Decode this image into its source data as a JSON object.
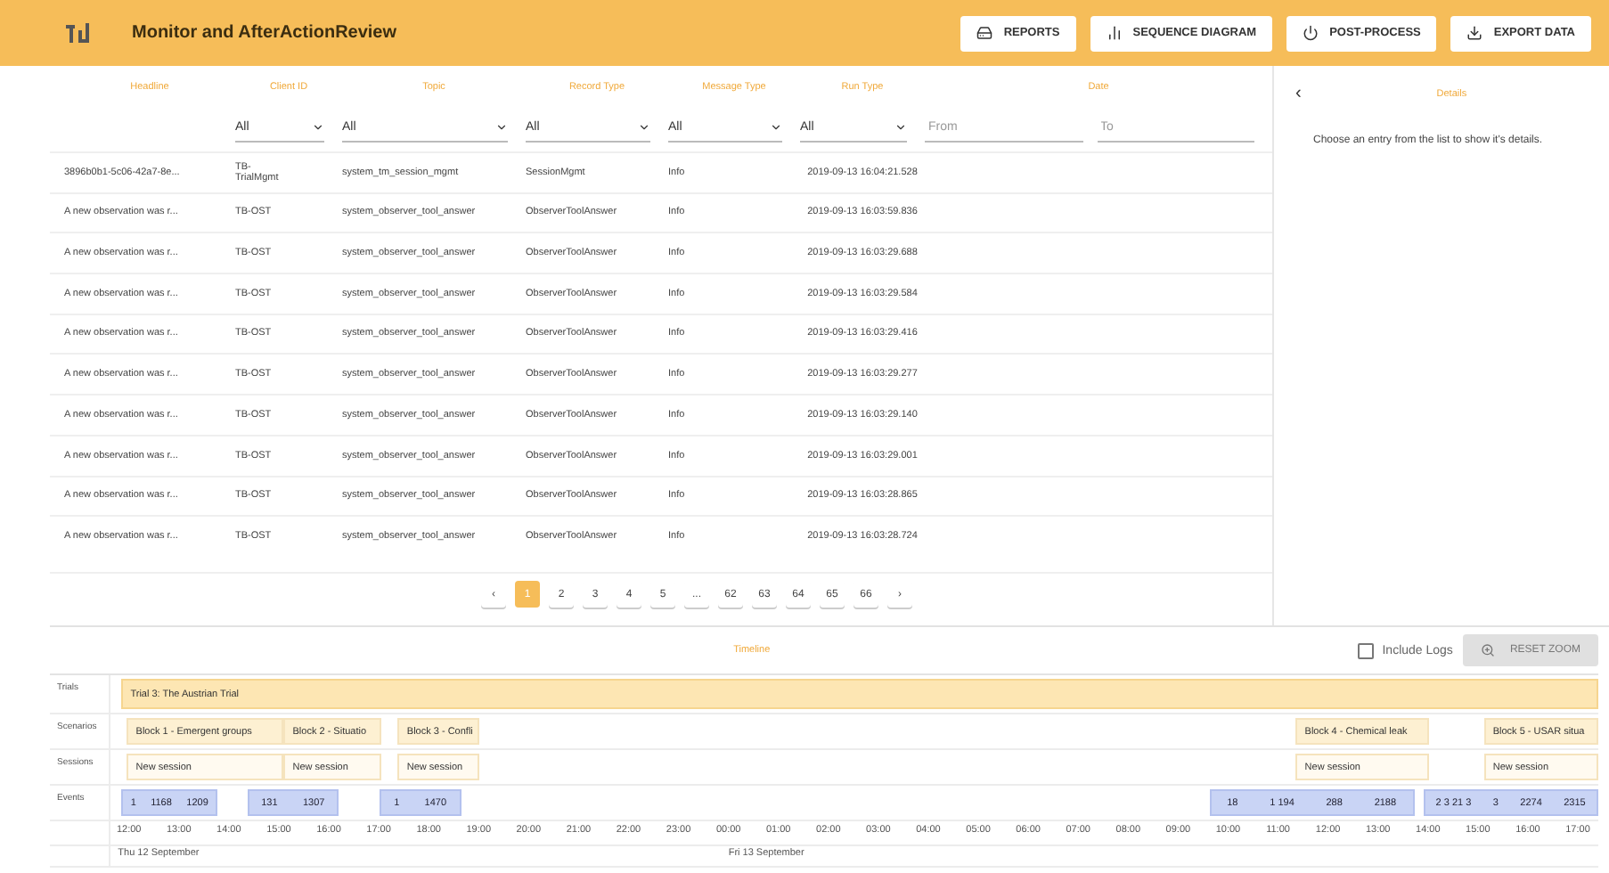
{
  "app": {
    "title": "Monitor and AfterActionReview"
  },
  "toolbar": [
    {
      "label": "REPORTS",
      "kind": "reports"
    },
    {
      "label": "SEQUENCE DIAGRAM",
      "kind": "chart"
    },
    {
      "label": "POST-PROCESS",
      "kind": "power"
    },
    {
      "label": "EXPORT DATA",
      "kind": "export"
    }
  ],
  "table": {
    "columns": [
      {
        "label": "Headline",
        "kind": "none"
      },
      {
        "label": "Client ID",
        "kind": "select",
        "value": "All"
      },
      {
        "label": "Topic",
        "kind": "select",
        "value": "All"
      },
      {
        "label": "Record Type",
        "kind": "select",
        "value": "All"
      },
      {
        "label": "Message Type",
        "kind": "select",
        "value": "All"
      },
      {
        "label": "Run Type",
        "kind": "select",
        "value": "All"
      },
      {
        "label": "Date",
        "kind": "range",
        "from_placeholder": "From",
        "to_placeholder": "To"
      }
    ],
    "rows": [
      [
        "3896b0b1-5c06-42a7-8e...",
        "TB-TrialMgmt",
        "system_tm_session_mgmt",
        "SessionMgmt",
        "Info",
        "2019-09-13 16:04:21.528"
      ],
      [
        "A new observation was r...",
        "TB-OST",
        "system_observer_tool_answer",
        "ObserverToolAnswer",
        "Info",
        "2019-09-13 16:03:59.836"
      ],
      [
        "A new observation was r...",
        "TB-OST",
        "system_observer_tool_answer",
        "ObserverToolAnswer",
        "Info",
        "2019-09-13 16:03:29.688"
      ],
      [
        "A new observation was r...",
        "TB-OST",
        "system_observer_tool_answer",
        "ObserverToolAnswer",
        "Info",
        "2019-09-13 16:03:29.584"
      ],
      [
        "A new observation was r...",
        "TB-OST",
        "system_observer_tool_answer",
        "ObserverToolAnswer",
        "Info",
        "2019-09-13 16:03:29.416"
      ],
      [
        "A new observation was r...",
        "TB-OST",
        "system_observer_tool_answer",
        "ObserverToolAnswer",
        "Info",
        "2019-09-13 16:03:29.277"
      ],
      [
        "A new observation was r...",
        "TB-OST",
        "system_observer_tool_answer",
        "ObserverToolAnswer",
        "Info",
        "2019-09-13 16:03:29.140"
      ],
      [
        "A new observation was r...",
        "TB-OST",
        "system_observer_tool_answer",
        "ObserverToolAnswer",
        "Info",
        "2019-09-13 16:03:29.001"
      ],
      [
        "A new observation was r...",
        "TB-OST",
        "system_observer_tool_answer",
        "ObserverToolAnswer",
        "Info",
        "2019-09-13 16:03:28.865"
      ],
      [
        "A new observation was r...",
        "TB-OST",
        "system_observer_tool_answer",
        "ObserverToolAnswer",
        "Info",
        "2019-09-13 16:03:28.724"
      ]
    ]
  },
  "pagination": {
    "prev": "‹",
    "next": "›",
    "pages": [
      {
        "label": "1",
        "selected": true
      },
      {
        "label": "2",
        "selected": false
      },
      {
        "label": "3",
        "selected": false
      },
      {
        "label": "4",
        "selected": false
      },
      {
        "label": "5",
        "selected": false
      },
      {
        "label": "...",
        "selected": false
      },
      {
        "label": "62",
        "selected": false
      },
      {
        "label": "63",
        "selected": false
      },
      {
        "label": "64",
        "selected": false
      },
      {
        "label": "65",
        "selected": false
      },
      {
        "label": "66",
        "selected": false
      }
    ]
  },
  "details": {
    "back": "‹",
    "title": "Details",
    "message": "Choose an entry from the list to show it's details."
  },
  "timeline": {
    "title": "Timeline",
    "include_logs": {
      "label": "Include Logs",
      "checked": false
    },
    "zoom_button": {
      "label": "RESET ZOOM",
      "disabled": true
    },
    "rows": [
      {
        "label": "Trials",
        "items": [
          "Trial 3: The Austrian Trial"
        ]
      },
      {
        "label": "Scenarios",
        "items": [
          "Block 1 - Emergent groups",
          "Block 2 - Situatio",
          "Block 3 - Confli",
          "Block 4 - Chemical leak",
          "Block 5 - USAR situa"
        ]
      },
      {
        "label": "Sessions",
        "items": [
          "New session",
          "New session",
          "New session",
          "New session",
          "New session"
        ]
      },
      {
        "label": "Events",
        "items": [
          [
            "1",
            "1168",
            "1209"
          ],
          [
            "131",
            "1307"
          ],
          [
            "1",
            "1470"
          ],
          [
            "18",
            "1 194",
            "288",
            "2188"
          ],
          [
            "2 3 21 3",
            "3",
            "2274",
            "2315"
          ]
        ]
      }
    ],
    "axis": [
      "12:00",
      "13:00",
      "14:00",
      "15:00",
      "16:00",
      "17:00",
      "18:00",
      "19:00",
      "20:00",
      "21:00",
      "22:00",
      "23:00",
      "00:00",
      "01:00",
      "02:00",
      "03:00",
      "04:00",
      "05:00",
      "06:00",
      "07:00",
      "08:00",
      "09:00",
      "10:00",
      "11:00",
      "12:00",
      "13:00",
      "14:00",
      "15:00",
      "16:00",
      "17:00"
    ],
    "dates": [
      "Thu 12 September",
      "Fri 13 September"
    ]
  }
}
